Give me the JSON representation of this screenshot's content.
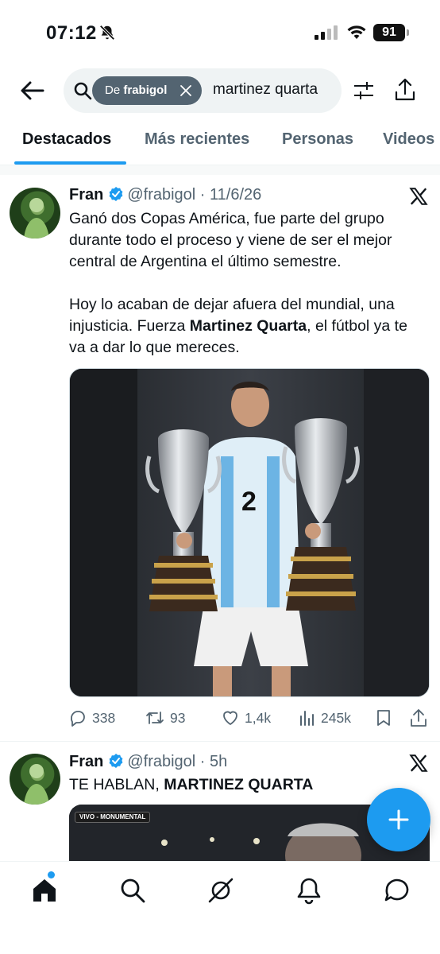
{
  "status_bar": {
    "time": "07:12",
    "battery": "91"
  },
  "search": {
    "chip_prefix": "De",
    "chip_user": "frabigol",
    "query": "martinez quarta"
  },
  "tabs": [
    {
      "label": "Destacados",
      "active": true
    },
    {
      "label": "Más recientes",
      "active": false
    },
    {
      "label": "Personas",
      "active": false
    },
    {
      "label": "Videos",
      "active": false
    }
  ],
  "tweets": [
    {
      "name": "Fran",
      "handle": "@frabigol",
      "date": "11/6/26",
      "paragraph1": "Ganó dos Copas América, fue parte del grupo durante todo el proceso y viene de ser el mejor central de Argentina el último semestre.",
      "paragraph2_before": "Hoy lo acaban de dejar afuera del mundial, una injusticia. Fuerza ",
      "paragraph2_bold": "Martinez Quarta",
      "paragraph2_after": ", el fútbol ya te va a dar lo que mereces.",
      "jersey_number": "2",
      "stats": {
        "replies": "338",
        "reposts": "93",
        "likes": "1,4k",
        "views": "245k"
      }
    },
    {
      "name": "Fran",
      "handle": "@frabigol",
      "date": "5h",
      "text_before": "TE HABLAN, ",
      "text_bold": "MARTINEZ QUARTA",
      "live_tag": "VIVO - MONUMENTAL"
    }
  ],
  "colors": {
    "accent": "#1d9bf0",
    "text": "#0f1419",
    "secondary": "#536471"
  },
  "icons": [
    "back-arrow-icon",
    "search-icon",
    "filter-icon",
    "share-icon",
    "verified-icon",
    "x-logo-icon",
    "reply-icon",
    "repost-icon",
    "like-icon",
    "views-icon",
    "bookmark-icon",
    "plus-icon",
    "home-icon",
    "explore-icon",
    "grok-icon",
    "notifications-icon",
    "messages-icon"
  ]
}
